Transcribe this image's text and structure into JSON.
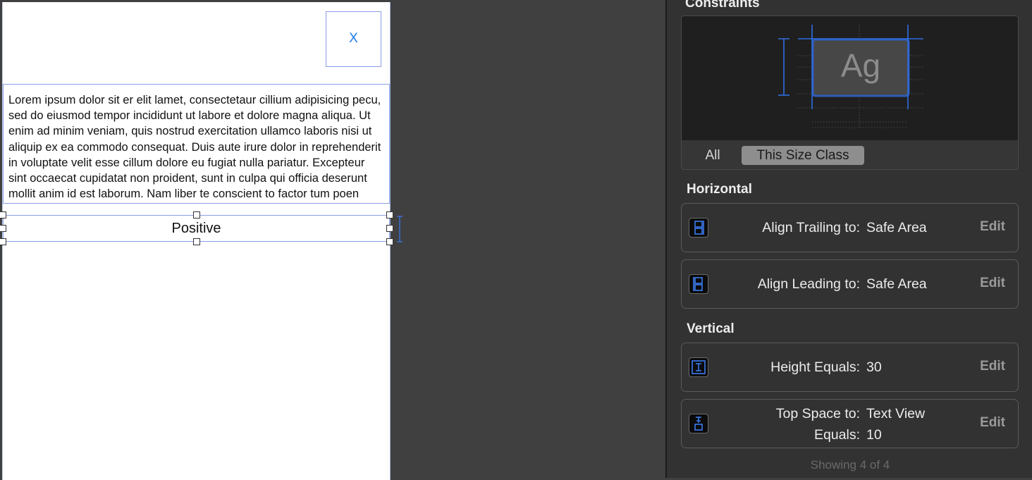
{
  "canvas": {
    "close_label": "X",
    "text_view": "Lorem ipsum dolor sit er elit lamet, consectetaur cillium adipisicing pecu, sed do eiusmod tempor incididunt ut labore et dolore magna aliqua. Ut enim ad minim veniam, quis nostrud exercitation ullamco laboris nisi ut aliquip ex ea commodo consequat. Duis aute irure dolor in reprehenderit in voluptate velit esse cillum dolore eu fugiat nulla pariatur. Excepteur sint occaecat cupidatat non proident, sunt in culpa qui officia deserunt mollit anim id est laborum. Nam liber te conscient to factor tum poen legum odioque civiuda.",
    "positive_label": "Positive"
  },
  "inspector": {
    "title": "Constraints",
    "diagram_text": "Ag",
    "segments": {
      "all": "All",
      "this_size_class": "This Size Class"
    },
    "horizontal": {
      "title": "Horizontal",
      "items": [
        {
          "label": "Align Trailing to:",
          "value": "Safe Area",
          "edit": "Edit",
          "icon": "align-trailing-icon"
        },
        {
          "label": "Align Leading to:",
          "value": "Safe Area",
          "edit": "Edit",
          "icon": "align-leading-icon"
        }
      ]
    },
    "vertical": {
      "title": "Vertical",
      "items": [
        {
          "label": "Height Equals:",
          "value": "30",
          "edit": "Edit",
          "icon": "height-icon"
        },
        {
          "label": "Top Space to:",
          "value": "Text View",
          "label2": "Equals:",
          "value2": "10",
          "edit": "Edit",
          "icon": "top-space-icon"
        }
      ]
    },
    "footer": "Showing 4 of 4"
  },
  "colors": {
    "selection": "#8a9ee6",
    "accent_blue": "#1d7cf2",
    "inspector_bg": "#323232",
    "canvas_bg": "#404040"
  }
}
